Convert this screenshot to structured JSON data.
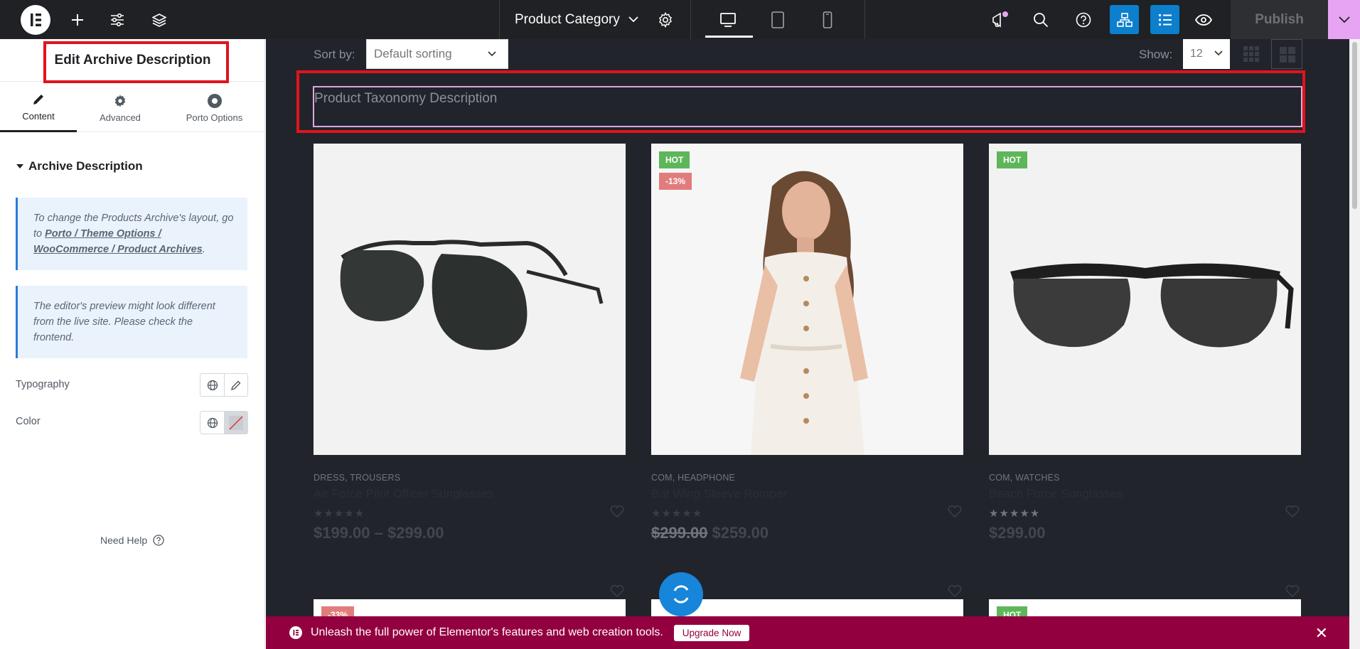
{
  "topbar": {
    "document_title": "Product Category",
    "publish_label": "Publish",
    "accent_color": "#0c7fcd",
    "icons": [
      "elementor-logo-icon",
      "add-icon",
      "sliders-icon",
      "layers-icon",
      "chevron-down-icon",
      "gear-icon",
      "desktop-icon",
      "tablet-icon",
      "mobile-icon",
      "megaphone-icon",
      "search-icon",
      "help-icon",
      "structure-icon",
      "navigator-icon",
      "eye-icon"
    ]
  },
  "panel": {
    "title": "Edit Archive Description",
    "tabs": [
      {
        "label": "Content",
        "icon": "pencil-icon"
      },
      {
        "label": "Advanced",
        "icon": "gear-icon"
      },
      {
        "label": "Porto Options",
        "icon": "porto-icon"
      }
    ],
    "section_title": "Archive Description",
    "notice1_pre": "To change the Products Archive's layout, go to ",
    "notice1_link": "Porto / Theme Options / WooCommerce / Product Archives",
    "notice1_post": ".",
    "notice2": "The editor's preview might look different from the live site. Please check the frontend.",
    "typography_label": "Typography",
    "color_label": "Color",
    "need_help": "Need Help"
  },
  "canvas": {
    "sort_label": "Sort by:",
    "sort_value": "Default sorting",
    "show_label": "Show:",
    "show_value": "12",
    "description_placeholder": "Product Taxonomy Description",
    "products": [
      {
        "badges": [],
        "categories": "DRESS, TROUSERS",
        "name": "Air Force Pilot Officer Sunglasses",
        "rating_filled": false,
        "price": "$199.00 – $299.00",
        "old_price": ""
      },
      {
        "badges": [
          "HOT",
          "-13%"
        ],
        "categories": "COM, HEADPHONE",
        "name": "Bat Wing Sleeve Romper",
        "rating_filled": false,
        "price": "$259.00",
        "old_price": "$299.00"
      },
      {
        "badges": [
          "HOT"
        ],
        "categories": "COM, WATCHES",
        "name": "Beach Force Sunglasses",
        "rating_filled": true,
        "price": "$299.00",
        "old_price": ""
      }
    ],
    "row2_badges": [
      "-33%",
      "HOT"
    ]
  },
  "promo": {
    "text": "Unleash the full power of Elementor's features and web creation tools.",
    "button": "Upgrade Now",
    "close": "✕",
    "color": "#93003f"
  }
}
